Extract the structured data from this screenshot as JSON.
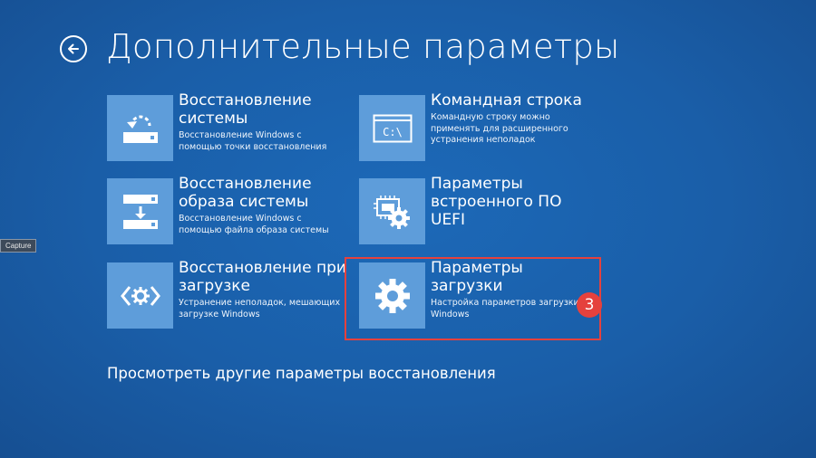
{
  "page": {
    "title": "Дополнительные параметры",
    "back_icon": "back-arrow-icon"
  },
  "tiles": [
    {
      "title": "Восстановление системы",
      "description": "Восстановление Windows с помощью точки восстановления",
      "icon": "system-restore-icon"
    },
    {
      "title": "Командная строка",
      "description": "Командную строку можно применять для расширенного устранения неполадок",
      "icon": "command-prompt-icon",
      "icon_text": "C:\\"
    },
    {
      "title": "Восстановление образа системы",
      "description": "Восстановление Windows с помощью файла образа системы",
      "icon": "system-image-recovery-icon"
    },
    {
      "title": "Параметры встроенного ПО UEFI",
      "description": "",
      "icon": "uefi-firmware-icon"
    },
    {
      "title": "Восстановление при загрузке",
      "description": "Устранение неполадок, мешающих загрузке Windows",
      "icon": "startup-repair-icon"
    },
    {
      "title": "Параметры загрузки",
      "description": "Настройка параметров загрузки Windows",
      "icon": "gear-icon"
    }
  ],
  "annotation": {
    "step_number": "3",
    "color": "#e5413d"
  },
  "footer": {
    "more_options_link": "Просмотреть другие параметры восстановления"
  },
  "capture_tooltip": "Capture",
  "colors": {
    "background": "#1a5ea8",
    "tile_icon_bg": "#5e9dda",
    "text": "#ffffff"
  }
}
